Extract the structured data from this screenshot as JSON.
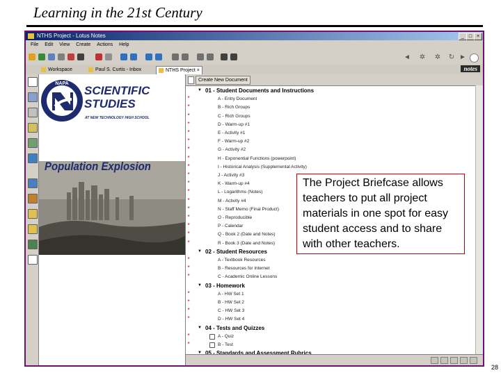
{
  "slide": {
    "title": "Learning in the 21st Century",
    "page_number": "28",
    "callout_text": "The Project Briefcase allows teachers to put all project materials in one spot for easy student access and to share with other teachers."
  },
  "window": {
    "title": "NTHS Project - Lotus Notes",
    "menu": [
      "File",
      "Edit",
      "View",
      "Create",
      "Actions",
      "Help"
    ],
    "tabs": [
      {
        "label": "Workspace"
      },
      {
        "label": "Paul S. Curtis - Inbox"
      },
      {
        "label": "NTHS Project"
      }
    ],
    "brand": "notes",
    "accent_color": "#6f0f6f"
  },
  "document": {
    "logo_name_line1": "SCIENTIFIC",
    "logo_name_line2": "STUDIES",
    "logo_seal_text": "NAPA",
    "logo_subtitle": "AT NEW TECHNOLOGY HIGH SCHOOL",
    "photo_title": "Population Explosion"
  },
  "view": {
    "create_button": "Create New Document",
    "rows": [
      {
        "kind": "cat",
        "text": "01 - Student Documents and Instructions"
      },
      {
        "kind": "doc",
        "text": "A - Entry Document",
        "mark": true
      },
      {
        "kind": "doc",
        "text": "B - Rich Groups",
        "mark": true
      },
      {
        "kind": "doc",
        "text": "C - Rich Groups",
        "mark": true
      },
      {
        "kind": "doc",
        "text": "D - Warm-up #1",
        "mark": true
      },
      {
        "kind": "doc",
        "text": "E - Activity #1",
        "mark": true
      },
      {
        "kind": "doc",
        "text": "F - Warm-up #2",
        "mark": true
      },
      {
        "kind": "doc",
        "text": "G - Activity #2",
        "mark": true
      },
      {
        "kind": "doc",
        "text": "H - Exponential Functions (powerpoint)",
        "mark": true
      },
      {
        "kind": "doc",
        "text": "I - Historical Analysis (Supplemental Activity)",
        "mark": true
      },
      {
        "kind": "doc",
        "text": "J - Activity #3",
        "mark": true
      },
      {
        "kind": "doc",
        "text": "K - Warm-up #4",
        "mark": true
      },
      {
        "kind": "doc",
        "text": "L - Logarithms (Notes)",
        "mark": true
      },
      {
        "kind": "doc",
        "text": "M - Activity #4",
        "mark": true
      },
      {
        "kind": "doc",
        "text": "N - Staff Memo (Final Product)",
        "mark": true
      },
      {
        "kind": "doc",
        "text": "O - Reproducible",
        "mark": true
      },
      {
        "kind": "doc",
        "text": "P - Calendar",
        "mark": true
      },
      {
        "kind": "doc",
        "text": "Q - Book 2 (Date and Notes)",
        "mark": true
      },
      {
        "kind": "doc",
        "text": "R - Book 3 (Date and Notes)",
        "mark": true
      },
      {
        "kind": "cat",
        "text": "02 - Student Resources"
      },
      {
        "kind": "doc",
        "text": "A - Textbook Resources",
        "mark": true
      },
      {
        "kind": "doc",
        "text": "B - Resources for Internet",
        "mark": true
      },
      {
        "kind": "doc",
        "text": "C - Academic Online Lessons",
        "mark": true
      },
      {
        "kind": "cat",
        "text": "03 - Homework"
      },
      {
        "kind": "doc",
        "text": "A - HW Set 1",
        "mark": true
      },
      {
        "kind": "doc",
        "text": "B - HW Set 2",
        "mark": true
      },
      {
        "kind": "doc",
        "text": "C - HW Set 3",
        "mark": true
      },
      {
        "kind": "doc",
        "text": "D - HW Set 4",
        "mark": true
      },
      {
        "kind": "cat",
        "text": "04 - Tests and Quizzes"
      },
      {
        "kind": "lock",
        "text": "A - Quiz",
        "mark": true
      },
      {
        "kind": "lock",
        "text": "B - Test",
        "mark": true
      },
      {
        "kind": "cat",
        "text": "05 - Standards and Assessment Rubrics"
      }
    ]
  }
}
